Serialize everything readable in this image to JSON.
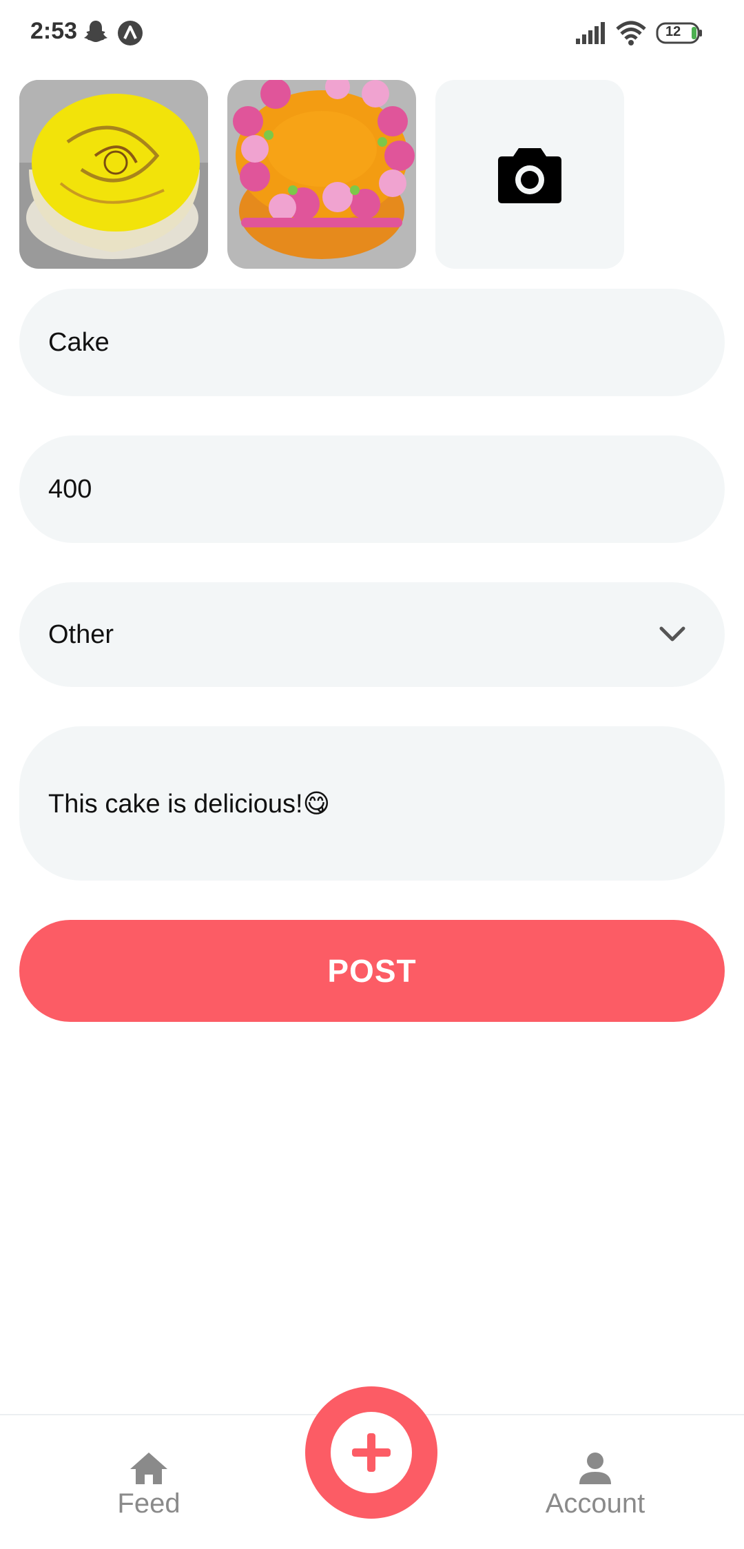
{
  "status_bar": {
    "time": "2:53",
    "battery": "12"
  },
  "photos": [
    {
      "name": "yellow-cake-photo"
    },
    {
      "name": "orange-rose-cake-photo"
    }
  ],
  "add_photo": {
    "icon": "camera-icon"
  },
  "form": {
    "title_value": "Cake",
    "price_value": "400",
    "category_value": "Other",
    "description_value": "This cake is delicious!😋",
    "post_label": "POST"
  },
  "nav": {
    "feed_label": "Feed",
    "account_label": "Account"
  },
  "colors": {
    "accent": "#fc5c65",
    "field_bg": "#f3f6f7",
    "nav_label": "#8a8a8a"
  }
}
